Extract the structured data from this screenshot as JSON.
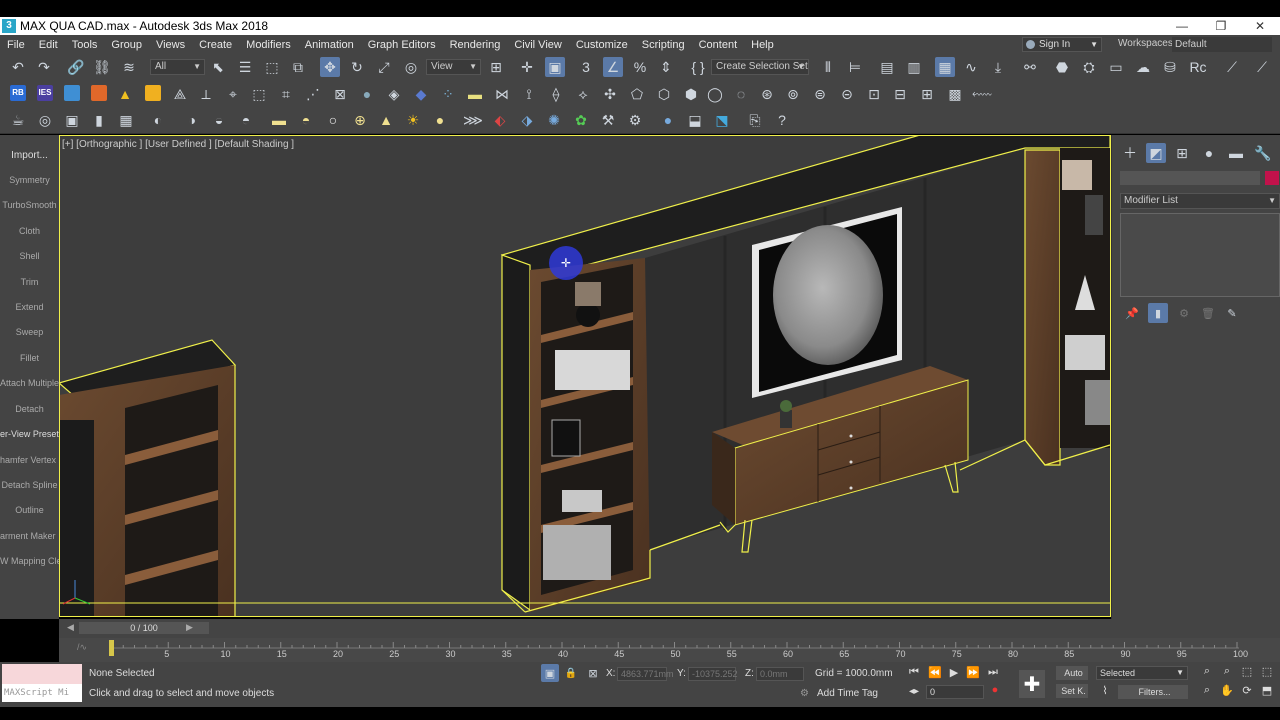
{
  "window": {
    "title": "MAX QUA CAD.max - Autodesk 3ds Max 2018",
    "app_icon": "3",
    "controls": [
      "—",
      "❐",
      "✕"
    ]
  },
  "menu": {
    "items": [
      "File",
      "Edit",
      "Tools",
      "Group",
      "Views",
      "Create",
      "Modifiers",
      "Animation",
      "Graph Editors",
      "Rendering",
      "Civil View",
      "Customize",
      "Scripting",
      "Content",
      "Help"
    ],
    "sign_in": "Sign In",
    "workspaces_label": "Workspaces:",
    "workspaces_value": "Default"
  },
  "toolbar": {
    "filter_value": "All",
    "refcoord_value": "View",
    "selection_set_placeholder": "Create Selection Set"
  },
  "toolbar2": {
    "badge_rb": "RB",
    "badge_ies": "IES"
  },
  "left_panel": {
    "import": "Import...",
    "items": [
      "Symmetry",
      "TurboSmooth",
      "Cloth",
      "Shell",
      "Trim",
      "Extend",
      "Sweep",
      "Fillet",
      "Attach Multiple",
      "Detach",
      "er-View Preset",
      "hamfer Vertex",
      "Detach Spline",
      "Outline",
      "arment Maker",
      "W Mapping Cle"
    ]
  },
  "viewport": {
    "label": "[+] [Orthographic ] [User Defined ] [Default Shading ]",
    "bg_color": "#3d3d3d",
    "selection_color": "#f0f04a"
  },
  "right_panel": {
    "modifier_list": "Modifier List",
    "object_color": "#c1124b"
  },
  "timeline": {
    "frame_display": "0 / 100",
    "ticks": [
      "5",
      "10",
      "15",
      "20",
      "25",
      "30",
      "35",
      "40",
      "45",
      "50",
      "55",
      "60",
      "65",
      "70",
      "75",
      "80",
      "85",
      "90",
      "95",
      "100"
    ]
  },
  "status": {
    "maxscript_placeholder": "MAXScript Mi",
    "selection_status": "None Selected",
    "prompt": "Click and drag to select and move objects",
    "x_label": "X:",
    "x_value": "4863.771mm",
    "y_label": "Y:",
    "y_value": "-10375.252",
    "z_label": "Z:",
    "z_value": "0.0mm",
    "grid": "Grid = 1000.0mm",
    "add_time_tag": "Add Time Tag",
    "auto_key": "Auto",
    "set_key": "Set K.",
    "key_mode_value": "Selected",
    "filters": "Filters...",
    "frame_value": "0"
  }
}
